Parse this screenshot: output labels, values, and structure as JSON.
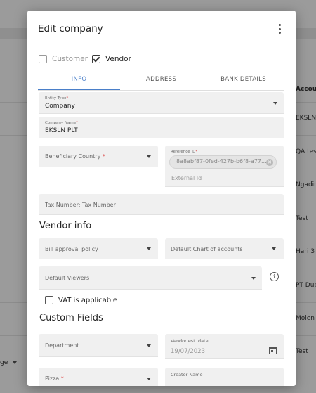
{
  "background": {
    "column_header": "Accou",
    "rows": [
      "EKSLN",
      "QA tes",
      "Ngadir",
      "Test",
      "Hari 3",
      "PT Dup",
      "Molen",
      "Test"
    ],
    "page_size_label": "ge"
  },
  "modal": {
    "title": "Edit company",
    "menu_icon": "more-vertical-icon",
    "checkboxes": {
      "customer": {
        "label": "Customer",
        "checked": false
      },
      "vendor": {
        "label": "Vendor",
        "checked": true
      }
    },
    "tabs": [
      {
        "label": "INFO",
        "active": true
      },
      {
        "label": "ADDRESS",
        "active": false
      },
      {
        "label": "BANK DETAILS",
        "active": false
      }
    ],
    "entity_type": {
      "label": "Entity Type",
      "value": "Company"
    },
    "company_name": {
      "label": "Company Name",
      "value": "EKSLN PLT"
    },
    "beneficiary_country": {
      "placeholder": "Beneficiary Country"
    },
    "reference_id": {
      "label": "Reference ID",
      "chip": "8a8abf87-0fed-427b-b6f8-a77...",
      "placeholder": "External Id"
    },
    "tax_number": {
      "placeholder": "Tax Number: Tax Number"
    },
    "vendor_info": {
      "title": "Vendor info",
      "bill_approval_policy": "Bill approval policy",
      "default_chart_of_accounts": "Default Chart of accounts",
      "default_viewers": "Default Viewers",
      "vat_label": "VAT is applicable",
      "vat_checked": false
    },
    "custom_fields": {
      "title": "Custom Fields",
      "department": "Department",
      "vendor_est_date": {
        "label": "Vendor est. date",
        "value": "19/07/2023"
      },
      "pizza": "Pizza",
      "creator_name": "Creator Name"
    },
    "required_mark": "*"
  }
}
